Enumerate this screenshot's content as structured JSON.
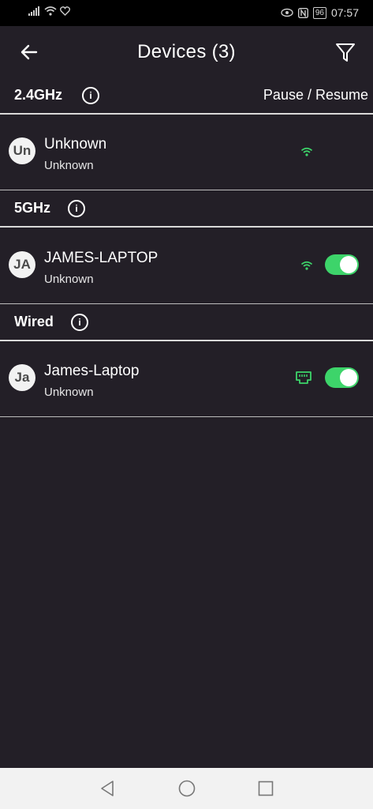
{
  "status_bar": {
    "time": "07:57",
    "battery": "96"
  },
  "header": {
    "title": "Devices (3)"
  },
  "sections": [
    {
      "label": "2.4GHz",
      "action_label": "Pause / Resume"
    },
    {
      "label": "5GHz"
    },
    {
      "label": "Wired"
    }
  ],
  "devices": [
    {
      "initials": "Un",
      "name": "Unknown",
      "subtitle": "Unknown",
      "connection": "wifi",
      "paused": null
    },
    {
      "initials": "JA",
      "name": "JAMES-LAPTOP",
      "subtitle": "Unknown",
      "connection": "wifi",
      "toggle_on": true
    },
    {
      "initials": "Ja",
      "name": "James-Laptop",
      "subtitle": "Unknown",
      "connection": "ethernet",
      "toggle_on": true
    }
  ],
  "colors": {
    "background": "#231f27",
    "accent": "#3dd46a",
    "divider": "#d9d9d9"
  },
  "icons": {
    "back": "arrow-left-icon",
    "filter": "filter-icon",
    "info": "info-icon",
    "wifi": "wifi-icon",
    "ethernet": "ethernet-icon",
    "nav_back": "triangle-back-icon",
    "nav_home": "circle-home-icon",
    "nav_recents": "square-recents-icon"
  }
}
